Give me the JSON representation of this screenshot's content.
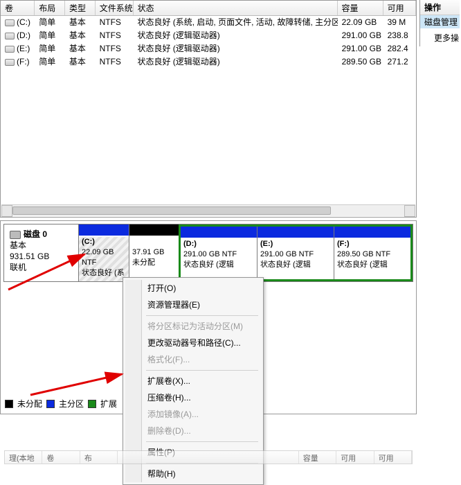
{
  "columns": {
    "volume": "卷",
    "layout": "布局",
    "type": "类型",
    "fs": "文件系统",
    "status": "状态",
    "capacity": "容量",
    "avail": "可用"
  },
  "actions_pane": {
    "header": "操作",
    "item1": "磁盘管理",
    "item2": "更多操"
  },
  "volumes": [
    {
      "drive": "(C:)",
      "layout": "简单",
      "type": "基本",
      "fs": "NTFS",
      "status": "状态良好 (系统, 启动, 页面文件, 活动, 故障转储, 主分区)",
      "capacity": "22.09 GB",
      "avail": "39 M"
    },
    {
      "drive": "(D:)",
      "layout": "简单",
      "type": "基本",
      "fs": "NTFS",
      "status": "状态良好 (逻辑驱动器)",
      "capacity": "291.00 GB",
      "avail": "238.8"
    },
    {
      "drive": "(E:)",
      "layout": "简单",
      "type": "基本",
      "fs": "NTFS",
      "status": "状态良好 (逻辑驱动器)",
      "capacity": "291.00 GB",
      "avail": "282.4"
    },
    {
      "drive": "(F:)",
      "layout": "简单",
      "type": "基本",
      "fs": "NTFS",
      "status": "状态良好 (逻辑驱动器)",
      "capacity": "289.50 GB",
      "avail": "271.2"
    }
  ],
  "disk": {
    "name": "磁盘 0",
    "kind": "基本",
    "size": "931.51 GB",
    "state": "联机"
  },
  "partitions": {
    "c": {
      "label": "(C:)",
      "size": "22.09 GB NTF",
      "status": "状态良好 (系"
    },
    "un": {
      "label": "",
      "size": "37.91 GB",
      "status": "未分配"
    },
    "d": {
      "label": "(D:)",
      "size": "291.00 GB NTF",
      "status": "状态良好 (逻辑"
    },
    "e": {
      "label": "(E:)",
      "size": "291.00 GB NTF",
      "status": "状态良好 (逻辑"
    },
    "f": {
      "label": "(F:)",
      "size": "289.50 GB NTF",
      "status": "状态良好 (逻辑"
    }
  },
  "legend": {
    "unalloc": "未分配",
    "primary": "主分区",
    "extended": "扩展"
  },
  "context_menu": {
    "open": "打开(O)",
    "explorer": "资源管理器(E)",
    "mark_active": "将分区标记为活动分区(M)",
    "change_letter": "更改驱动器号和路径(C)...",
    "format": "格式化(F)...",
    "extend": "扩展卷(X)...",
    "shrink": "压缩卷(H)...",
    "mirror": "添加镜像(A)...",
    "delete": "删除卷(D)...",
    "properties": "属性(P)",
    "help": "帮助(H)"
  },
  "bottom_strip": {
    "a": "理(本地",
    "b": "卷",
    "c": "布",
    "d": "容量",
    "e": "可用",
    "f": "可用"
  }
}
